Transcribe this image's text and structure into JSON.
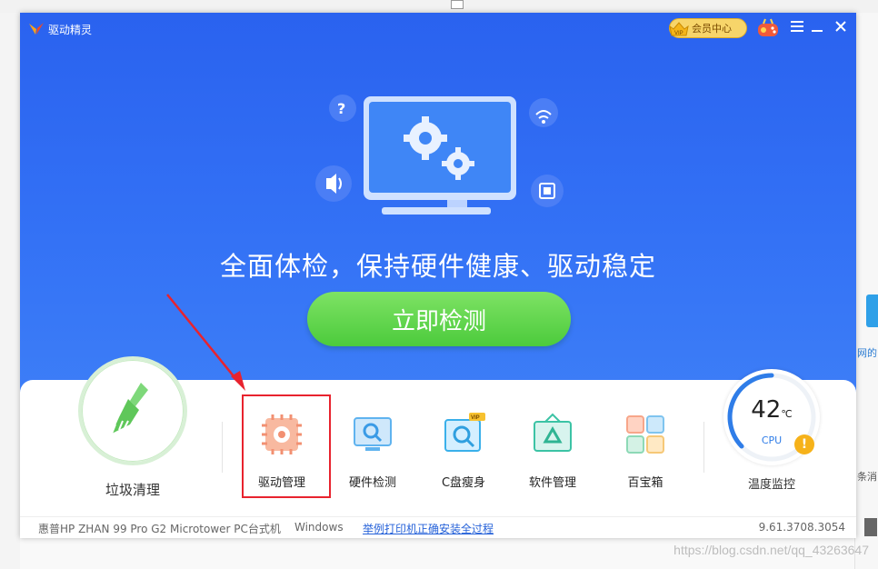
{
  "app": {
    "title": "驱动精灵"
  },
  "header": {
    "vip_label": "会员中心"
  },
  "hero": {
    "headline": "全面体检，保持硬件健康、驱动稳定",
    "scan_button": "立即检测"
  },
  "clean": {
    "label": "垃圾清理"
  },
  "tools": [
    {
      "label": "驱动管理",
      "icon": "chip-gear-icon"
    },
    {
      "label": "硬件检测",
      "icon": "monitor-search-icon"
    },
    {
      "label": "C盘瘦身",
      "icon": "disk-search-icon",
      "badge": "VIP"
    },
    {
      "label": "软件管理",
      "icon": "software-box-icon"
    },
    {
      "label": "百宝箱",
      "icon": "grid-apps-icon"
    }
  ],
  "temperature": {
    "value": "42",
    "unit": "℃",
    "sensor": "CPU",
    "label": "温度监控"
  },
  "status": {
    "device": "惠普HP ZHAN 99 Pro G2 Microtower PC台式机",
    "os": "Windows",
    "link": "举例打印机正确安装全过程",
    "version": "9.61.3708.3054"
  },
  "background": {
    "right_text_1": "网的",
    "right_text_2": "条消"
  },
  "watermark": "https://blog.csdn.net/qq_43263647",
  "colors": {
    "hero": "#3068f2",
    "scan_button": "#5ad048",
    "highlight": "#e8232e",
    "link": "#2662d9"
  }
}
